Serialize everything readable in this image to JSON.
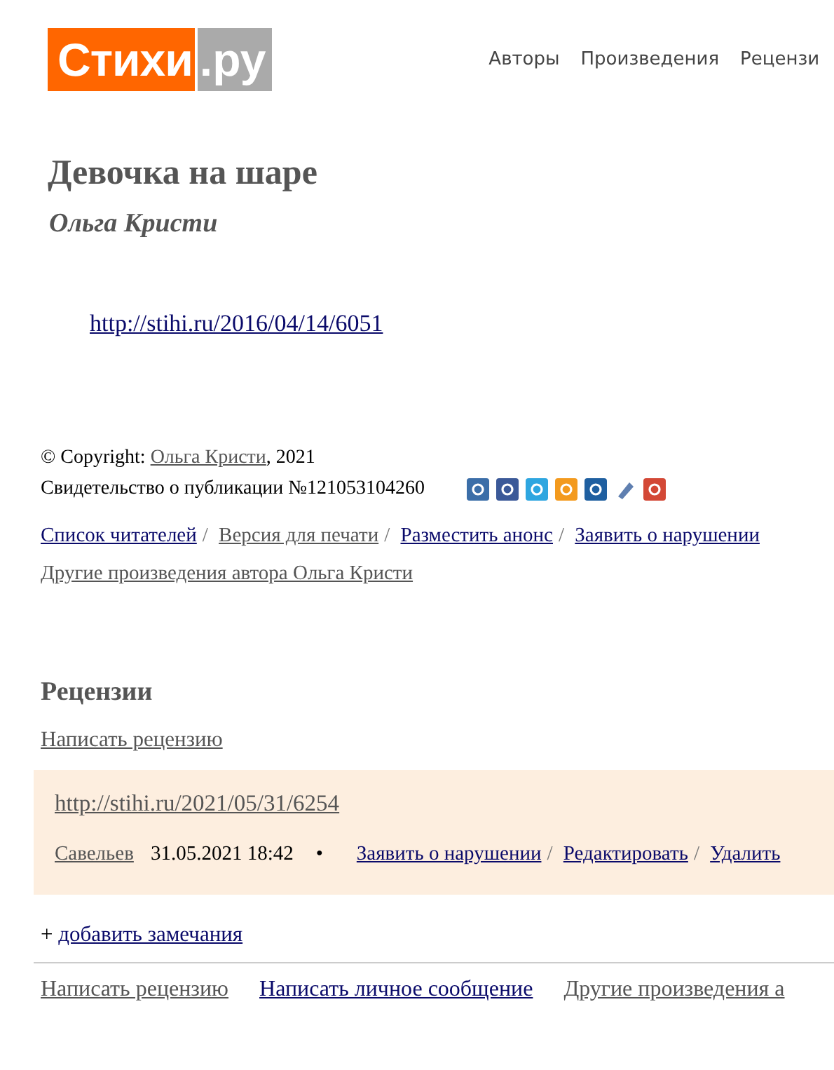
{
  "logo": {
    "main": "Стихи",
    "suffix": ".ру"
  },
  "nav": [
    {
      "label": "Авторы"
    },
    {
      "label": "Произведения"
    },
    {
      "label": "Рецензи"
    }
  ],
  "poem": {
    "title": "Девочка на шаре",
    "author": "Ольга Кристи",
    "link": {
      "text": "http://stihi.ru/2016/04/14/6051",
      "visited": false
    }
  },
  "copyright": {
    "prefix": "© Copyright:",
    "author": {
      "text": "Ольга Кристи",
      "visited": true
    },
    "year": ", 2021",
    "certificate": "Свидетельство о публикации №121053104260"
  },
  "share_icons": [
    {
      "color": "#3b6ea8"
    },
    {
      "color": "#3b5998"
    },
    {
      "color": "#2ea6e0"
    },
    {
      "color": "#f39a1e"
    },
    {
      "color": "#1f5fa0"
    },
    {
      "color": "#5f7fb0"
    },
    {
      "color": "#d34836"
    }
  ],
  "actions": [
    {
      "text": "Список читателей",
      "visited": false
    },
    {
      "separator": "/",
      "text": "Версия для печати",
      "visited": true
    },
    {
      "separator": "/",
      "text": "Разместить анонс",
      "visited": false
    },
    {
      "separator": "/",
      "text": "Заявить о нарушении",
      "visited": false
    }
  ],
  "other_works": {
    "text": "Другие произведения автора Ольга Кристи",
    "visited": true
  },
  "reviews": {
    "heading": "Рецензии",
    "write": {
      "text": "Написать рецензию",
      "visited": true
    },
    "items": [
      {
        "link": {
          "text": "http://stihi.ru/2021/05/31/6254",
          "visited": true
        },
        "author": {
          "text": "Савельев",
          "visited": true
        },
        "date": "31.05.2021 18:42",
        "bullet": "•",
        "actions": [
          {
            "text": "Заявить о нарушении",
            "visited": false
          },
          {
            "separator": "/",
            "text": "Редактировать",
            "visited": false
          },
          {
            "separator": "/",
            "text": "Удалить",
            "visited": false
          }
        ]
      }
    ],
    "add_plus": "+",
    "add": {
      "text": "добавить замечания",
      "visited": false
    }
  },
  "footer_links": [
    {
      "text": "Написать рецензию",
      "visited": true
    },
    {
      "text": "Написать личное сообщение",
      "visited": false
    },
    {
      "text": "Другие произведения а",
      "visited": true
    }
  ]
}
